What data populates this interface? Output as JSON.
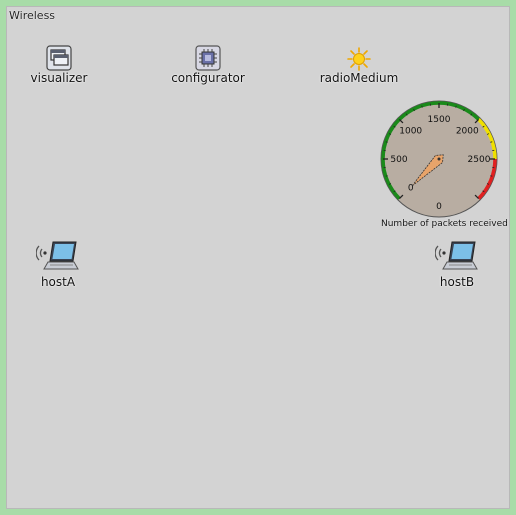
{
  "network": {
    "title": "Wireless"
  },
  "nodes": {
    "visualizer": {
      "label": "visualizer",
      "icon": "visualizer-window-icon"
    },
    "configurator": {
      "label": "configurator",
      "icon": "chip-icon"
    },
    "radioMedium": {
      "label": "radioMedium",
      "icon": "sun-icon"
    },
    "hostA": {
      "label": "hostA",
      "icon": "wireless-laptop-icon"
    },
    "hostB": {
      "label": "hostB",
      "icon": "wireless-laptop-icon"
    }
  },
  "gauge": {
    "caption": "Number of packets received",
    "tick_labels": [
      "0",
      "500",
      "1000",
      "1500",
      "2000",
      "2500"
    ],
    "bottom_label": "0",
    "min": 0,
    "max": 3000,
    "value": 0,
    "colors": {
      "green": "#1a8a1a",
      "yellow": "#f0e000",
      "red": "#e02020",
      "face": "#b8ada2",
      "needle": "#e8a46a"
    }
  }
}
